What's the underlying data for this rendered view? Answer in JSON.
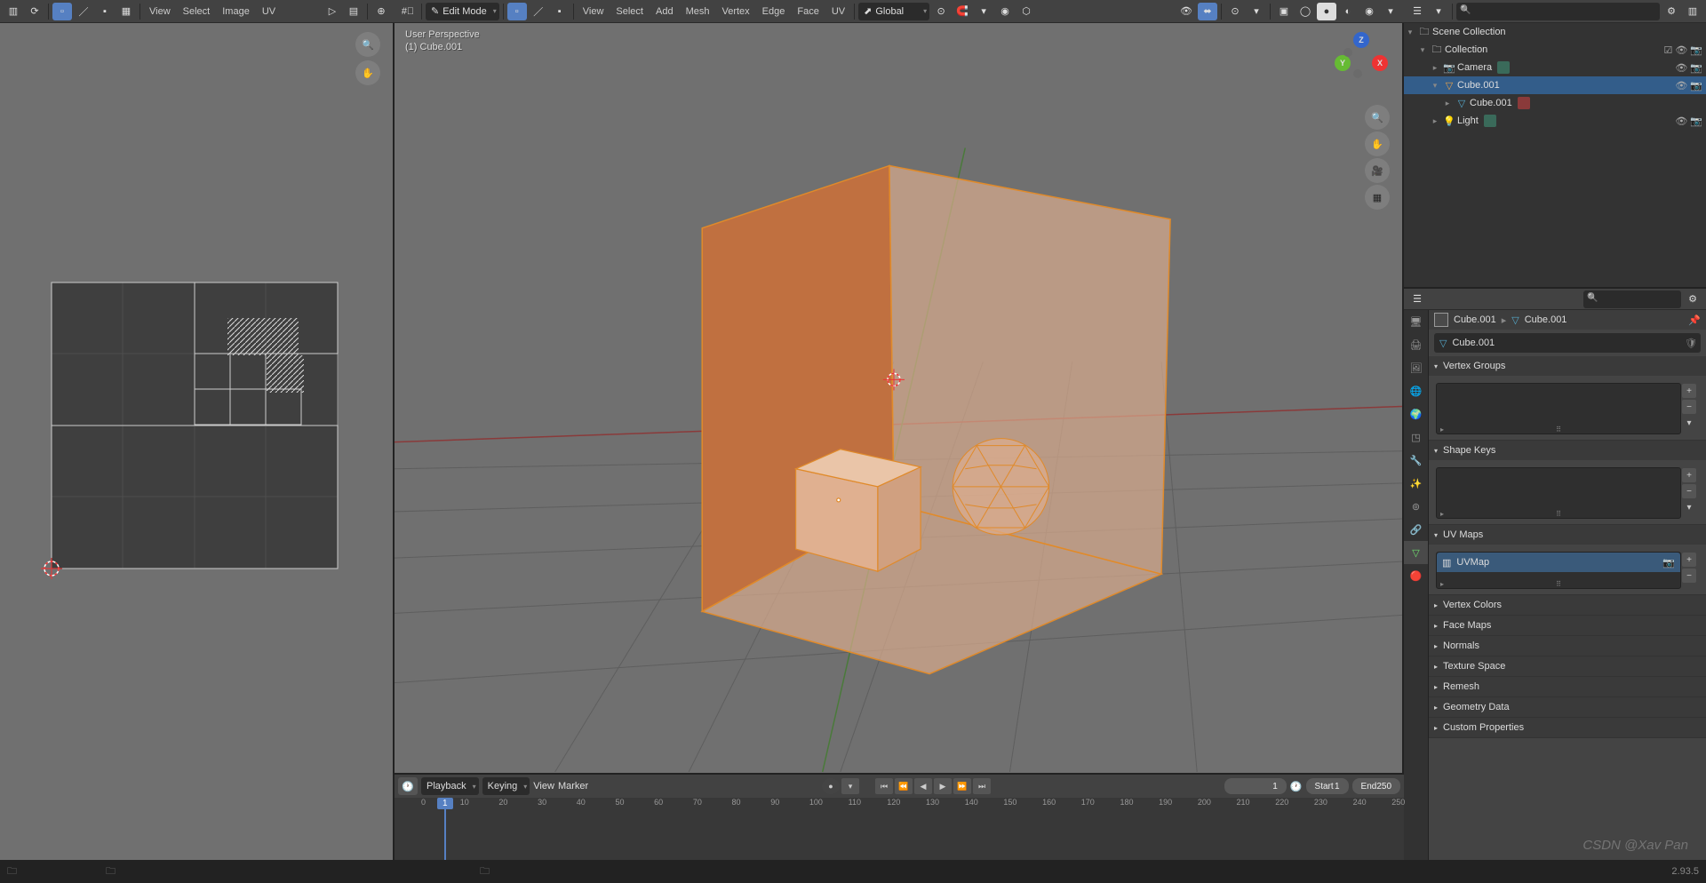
{
  "uv_header": {
    "menus": [
      "View",
      "Select",
      "Image",
      "UV"
    ]
  },
  "vp_header": {
    "mode": "Edit Mode",
    "menus": [
      "View",
      "Select",
      "Add",
      "Mesh",
      "Vertex",
      "Edge",
      "Face",
      "UV"
    ],
    "orient": "Global"
  },
  "vp_info": {
    "persp": "User Perspective",
    "obj": "(1) Cube.001"
  },
  "gizmo": {
    "x": "X",
    "y": "Y",
    "z": "Z"
  },
  "outliner": {
    "root": "Scene Collection",
    "collection": "Collection",
    "items": [
      "Camera",
      "Cube.001",
      "Cube.001",
      "Light"
    ]
  },
  "breadcrumb": {
    "a": "Cube.001",
    "b": "Cube.001"
  },
  "name_field": "Cube.001",
  "panels": {
    "vg": "Vertex Groups",
    "sk": "Shape Keys",
    "uv": "UV Maps",
    "uvmap": "UVMap",
    "vc": "Vertex Colors",
    "fm": "Face Maps",
    "nm": "Normals",
    "ts": "Texture Space",
    "rm": "Remesh",
    "gd": "Geometry Data",
    "cp": "Custom Properties"
  },
  "timeline": {
    "menus": [
      "Playback",
      "Keying",
      "View",
      "Marker"
    ],
    "frame": "1",
    "start_lbl": "Start",
    "start": "1",
    "end_lbl": "End",
    "end": "250",
    "ticks": [
      0,
      10,
      20,
      30,
      40,
      50,
      60,
      70,
      80,
      90,
      100,
      110,
      120,
      130,
      140,
      150,
      160,
      170,
      180,
      190,
      200,
      210,
      220,
      230,
      240,
      250
    ]
  },
  "status": "2.93.5",
  "watermark": "CSDN @Xav Pan"
}
